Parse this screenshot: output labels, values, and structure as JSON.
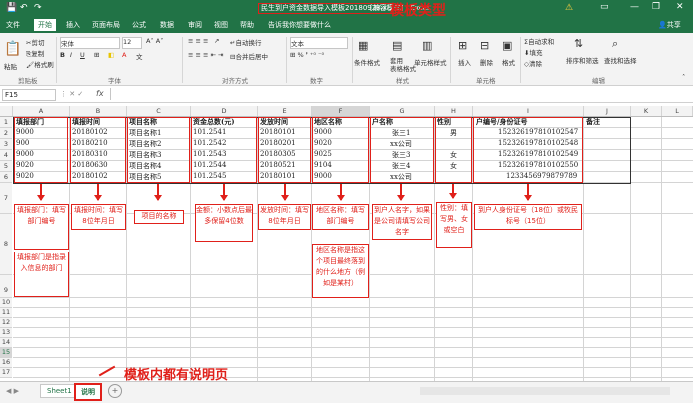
{
  "titlebar": {
    "doc_title": "民生到户资金数据导入模板20180923.xls",
    "mode": "[兼容模式] - Excel",
    "template_type_label": "模板类型",
    "minimize": "—",
    "restore": "❐",
    "close": "✕"
  },
  "menu_tabs": [
    "文件",
    "开始",
    "插入",
    "页面布局",
    "公式",
    "数据",
    "审阅",
    "视图",
    "帮助",
    "告诉我你想要做什么"
  ],
  "share_label": "共享",
  "ribbon": {
    "clipboard": {
      "paste": "粘贴",
      "cut": "剪切",
      "copy": "复制",
      "painter": "格式刷",
      "group": "剪贴板"
    },
    "font": {
      "name": "宋体",
      "size": "12",
      "group": "字体"
    },
    "alignment": {
      "wrap": "自动换行",
      "merge": "合并后居中",
      "group": "对齐方式"
    },
    "number": {
      "format": "文本",
      "group": "数字"
    },
    "styles": {
      "conditional": "条件格式",
      "table": "套用\n表格格式",
      "cell": "单元格样式",
      "group": "样式"
    },
    "cells": {
      "insert": "插入",
      "delete": "删除",
      "format": "格式",
      "group": "单元格"
    },
    "editing": {
      "autosum": "自动求和",
      "fill": "填充",
      "clear": "清除",
      "sort": "排序和筛选",
      "find": "查找和选择",
      "group": "编辑"
    }
  },
  "formula_bar": {
    "name_box": "F15",
    "fx": "fx",
    "value": ""
  },
  "columns": [
    "A",
    "B",
    "C",
    "D",
    "E",
    "F",
    "G",
    "H",
    "I",
    "J",
    "K",
    "L"
  ],
  "row_numbers": [
    "1",
    "2",
    "3",
    "4",
    "5",
    "6",
    "7",
    "8",
    "9",
    "10",
    "11",
    "12",
    "13",
    "14",
    "15",
    "16",
    "17"
  ],
  "table": {
    "headers": [
      "填报部门",
      "填报时间",
      "项目名称",
      "资金总数(元)",
      "发放时间",
      "地区名称",
      "户名称",
      "性别",
      "户编号/身份证号",
      "备注"
    ],
    "rows": [
      [
        "9000",
        "20180102",
        "项目名称1",
        "101.2541",
        "20180101",
        "9000",
        "张三1",
        "男",
        "152326197810102547"
      ],
      [
        "900",
        "20180210",
        "项目名称2",
        "101.2542",
        "20180201",
        "9020",
        "xx公司",
        "",
        "152326197810102548"
      ],
      [
        "9000",
        "20180310",
        "项目名称3",
        "101.2543",
        "20180305",
        "9025",
        "张三3",
        "女",
        "152326197810102549"
      ],
      [
        "9020",
        "20180630",
        "项目名称4",
        "101.2544",
        "20180521",
        "9104",
        "张三4",
        "女",
        "152326197810102550"
      ],
      [
        "9020",
        "20180102",
        "项目名称5",
        "101.2545",
        "20180101",
        "9000",
        "xx公司",
        "",
        "1233456979879789"
      ]
    ]
  },
  "notes": {
    "a_top": "填报部门：填写部门编号",
    "a_bottom": "填报部门是指录入信息的部门",
    "b": "填报时间：填写8位年月日",
    "c": "项目的名称",
    "d": "金额：小数点后最多保留4位数",
    "e": "发放时间：填写8位年月日",
    "f_top": "地区名称：填写部门编号",
    "f_bottom": "地区名称是指这个项目最终落到的什么地方（例如是某村）",
    "g": "到户人名字，如果是公司请填写公司名字",
    "h": "性别：填写男、女或空白",
    "i": "到户人身份证号（18位）或牧民标号（15位）"
  },
  "sheets": [
    "Sheet1",
    "说明"
  ],
  "add_sheet": "+",
  "sheet_note": "模板内都有说明页",
  "colors": {
    "excel_green": "#217346",
    "annotation_red": "#e0201a"
  }
}
